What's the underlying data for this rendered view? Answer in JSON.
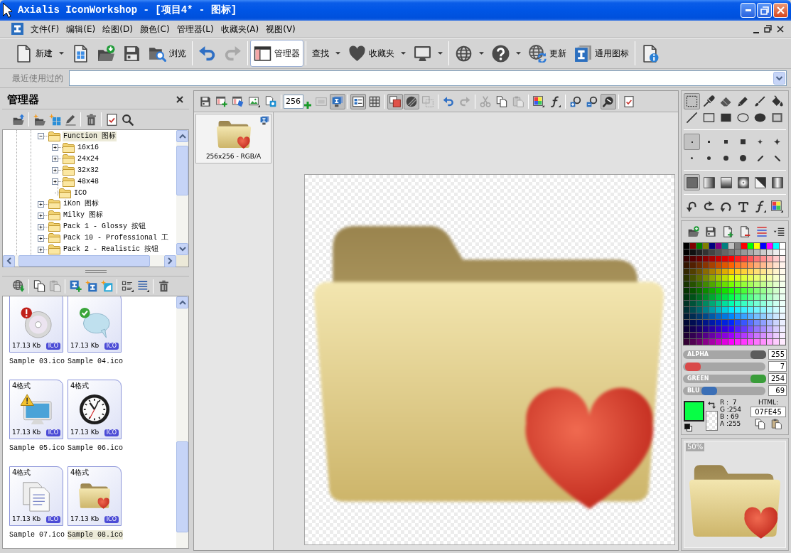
{
  "window": {
    "title": "Axialis IconWorkshop - [项目4* - 图标]"
  },
  "menu": {
    "items": [
      "文件(F)",
      "编辑(E)",
      "绘图(D)",
      "颜色(C)",
      "管理器(L)",
      "收藏夹(A)",
      "视图(V)"
    ]
  },
  "toolbar": [
    [
      {
        "label": "新建",
        "dropdown": true,
        "disabled": false,
        "pressed": false
      },
      {
        "dropdown": false,
        "disabled": false,
        "pressed": false
      },
      {
        "dropdown": false,
        "disabled": false,
        "pressed": false
      },
      {
        "dropdown": false,
        "disabled": false,
        "pressed": false
      },
      {
        "label": "浏览",
        "dropdown": false,
        "disabled": false,
        "pressed": false
      }
    ],
    [
      {
        "dropdown": false,
        "disabled": false,
        "pressed": false
      },
      {
        "dropdown": false,
        "disabled": true,
        "pressed": false
      }
    ],
    [
      {
        "label": "管理器",
        "dropdown": false,
        "disabled": false,
        "pressed": true
      }
    ],
    [
      {
        "label": "查找",
        "dropdown": true,
        "disabled": false,
        "pressed": false
      },
      {
        "label": "收藏夹",
        "dropdown": true,
        "disabled": false,
        "pressed": false
      },
      {
        "dropdown": true,
        "disabled": false,
        "pressed": false
      }
    ],
    [
      {
        "dropdown": true,
        "disabled": false,
        "pressed": false
      },
      {
        "dropdown": true,
        "disabled": false,
        "pressed": false
      },
      {
        "label": "更新",
        "dropdown": false,
        "disabled": false,
        "pressed": false
      },
      {
        "label": "通用图标",
        "dropdown": false,
        "disabled": false,
        "pressed": false
      }
    ],
    [
      {
        "dropdown": false,
        "disabled": false,
        "pressed": false
      }
    ]
  ],
  "recent": {
    "label": "最近使用过的"
  },
  "manager": {
    "title": "管理器",
    "tree": [
      {
        "label": "Function 图标",
        "expanded": true,
        "selected": true,
        "children": [
          {
            "label": "16x16",
            "expanded": false,
            "selected": false
          },
          {
            "label": "24x24",
            "expanded": false,
            "selected": false
          },
          {
            "label": "32x32",
            "expanded": false,
            "selected": false
          },
          {
            "label": "48x48",
            "expanded": false,
            "selected": false
          },
          {
            "label": "ICO",
            "selected": false
          }
        ]
      },
      {
        "label": "iKon 图标",
        "expanded": false,
        "selected": false
      },
      {
        "label": "Milky 图标",
        "expanded": false,
        "selected": false
      },
      {
        "label": "Pack 1 - Glossy 按钮",
        "expanded": false,
        "selected": false
      },
      {
        "label": "Pack 10 - Professional 工",
        "expanded": false,
        "selected": false
      },
      {
        "label": "Pack 2 - Realistic 按钮",
        "expanded": false,
        "selected": false
      }
    ],
    "files_toolbar": [
      {
        "disabled": false
      },
      {
        "disabled": false
      },
      {
        "disabled": true
      },
      {
        "disabled": false
      },
      {
        "disabled": false
      },
      {
        "disabled": false
      },
      {
        "disabled": false
      },
      {
        "disabled": false
      },
      {
        "disabled": false
      }
    ],
    "files": [
      {
        "name": "Sample 03.ico",
        "size": "17.13 Kb",
        "type": "ICO",
        "selected": false
      },
      {
        "name": "Sample 04.ico",
        "size": "17.13 Kb",
        "type": "ICO",
        "selected": false
      },
      {
        "formats": "4格式",
        "name": "Sample 05.ico",
        "size": "17.13 Kb",
        "type": "ICO",
        "selected": false
      },
      {
        "formats": "4格式",
        "name": "Sample 06.ico",
        "size": "17.13 Kb",
        "type": "ICO",
        "selected": false
      },
      {
        "formats": "4格式",
        "name": "Sample 07.ico",
        "size": "17.13 Kb",
        "type": "ICO",
        "selected": false
      },
      {
        "formats": "4格式",
        "name": "Sample 08.ico",
        "size": "17.13 Kb",
        "type": "ICO",
        "selected": true
      }
    ]
  },
  "editor": {
    "toolbar": [
      [
        {
          "disabled": false,
          "pressed": false
        },
        {
          "disabled": false,
          "pressed": false
        },
        {
          "disabled": false,
          "pressed": false
        },
        {
          "disabled": false,
          "pressed": false
        },
        {
          "disabled": false,
          "pressed": false
        }
      ],
      [
        {
          "disabled": true,
          "pressed": false
        },
        {
          "disabled": false,
          "pressed": true
        }
      ],
      [
        {
          "disabled": false,
          "pressed": true
        },
        {
          "disabled": false,
          "pressed": false
        }
      ],
      [
        {
          "disabled": false,
          "pressed": true
        },
        {
          "disabled": false,
          "pressed": true
        },
        {
          "disabled": true,
          "pressed": false
        }
      ],
      [
        {
          "disabled": false,
          "pressed": false
        },
        {
          "disabled": true,
          "pressed": false
        }
      ],
      [
        {
          "disabled": true,
          "pressed": false
        },
        {
          "disabled": false,
          "pressed": false
        },
        {
          "disabled": true,
          "pressed": false
        }
      ],
      [
        {
          "disabled": false,
          "pressed": false
        },
        {
          "disabled": false,
          "pressed": false
        }
      ],
      [
        {
          "disabled": false,
          "pressed": false
        },
        {
          "disabled": false,
          "pressed": false
        },
        {
          "disabled": false,
          "pressed": true
        }
      ]
    ],
    "size_field": {
      "value": "256"
    },
    "formats": [
      {
        "label": "256x256 - RGB/A",
        "selected": true
      }
    ]
  },
  "tools": {
    "shapes": [
      {
        "selected": true
      },
      {
        "selected": false
      },
      {
        "selected": false
      },
      {
        "selected": false
      },
      {
        "selected": false
      },
      {
        "selected": false
      },
      {
        "selected": false
      },
      {
        "selected": false
      },
      {
        "selected": false
      },
      {
        "selected": false
      },
      {
        "selected": false
      },
      {
        "selected": false
      }
    ],
    "brushes": [
      {
        "selected": true
      },
      {
        "selected": false
      },
      {
        "selected": false
      },
      {
        "selected": false
      },
      {
        "selected": false
      },
      {
        "selected": false
      },
      {
        "selected": false
      },
      {
        "selected": false
      },
      {
        "selected": false
      },
      {
        "selected": false
      },
      {
        "selected": false
      },
      {
        "selected": false
      }
    ],
    "fills": [
      {
        "selected": true
      },
      {
        "selected": false
      },
      {
        "selected": false
      },
      {
        "selected": false
      },
      {
        "selected": false
      },
      {
        "selected": false
      }
    ]
  },
  "color": {
    "sliders": [
      {
        "label": "ALPHA",
        "level": 1,
        "value": "255",
        "color": "#5c5c5c"
      },
      {
        "level": 0.027,
        "value": "7",
        "color": "#d94a4a"
      },
      {
        "label": "GREEN",
        "level": 0.996,
        "value": "254",
        "color": "#3a9d3a"
      },
      {
        "label": "BLU",
        "level": 0.271,
        "value": "69",
        "color": "#3b6fb6"
      }
    ],
    "readout": [
      "R :  7",
      "G :254",
      "B : 69",
      "A :255"
    ],
    "html_label": "HTML:",
    "html_value": "07FE45"
  },
  "preview": {
    "zoom": "50%"
  }
}
